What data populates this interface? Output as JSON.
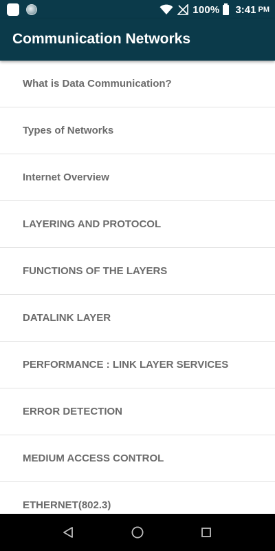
{
  "status_bar": {
    "battery_percent": "100%",
    "time": "3:41",
    "ampm": "PM",
    "icons": [
      "notification-app-icon",
      "notification-circle-icon",
      "wifi-icon",
      "no-signal-icon",
      "battery-icon"
    ]
  },
  "app_bar": {
    "title": "Communication Networks",
    "background_color": "#0b3a4a"
  },
  "topics": [
    {
      "label": "What is Data Communication?"
    },
    {
      "label": "Types of Networks"
    },
    {
      "label": "Internet Overview"
    },
    {
      "label": "LAYERING AND PROTOCOL"
    },
    {
      "label": "FUNCTIONS OF THE LAYERS"
    },
    {
      "label": "DATALINK LAYER"
    },
    {
      "label": "PERFORMANCE : LINK LAYER SERVICES"
    },
    {
      "label": "ERROR DETECTION"
    },
    {
      "label": "MEDIUM ACCESS CONTROL"
    },
    {
      "label": "ETHERNET(802.3)"
    }
  ],
  "nav_bar": {
    "icons": [
      "back-icon",
      "home-icon",
      "recents-icon"
    ]
  }
}
